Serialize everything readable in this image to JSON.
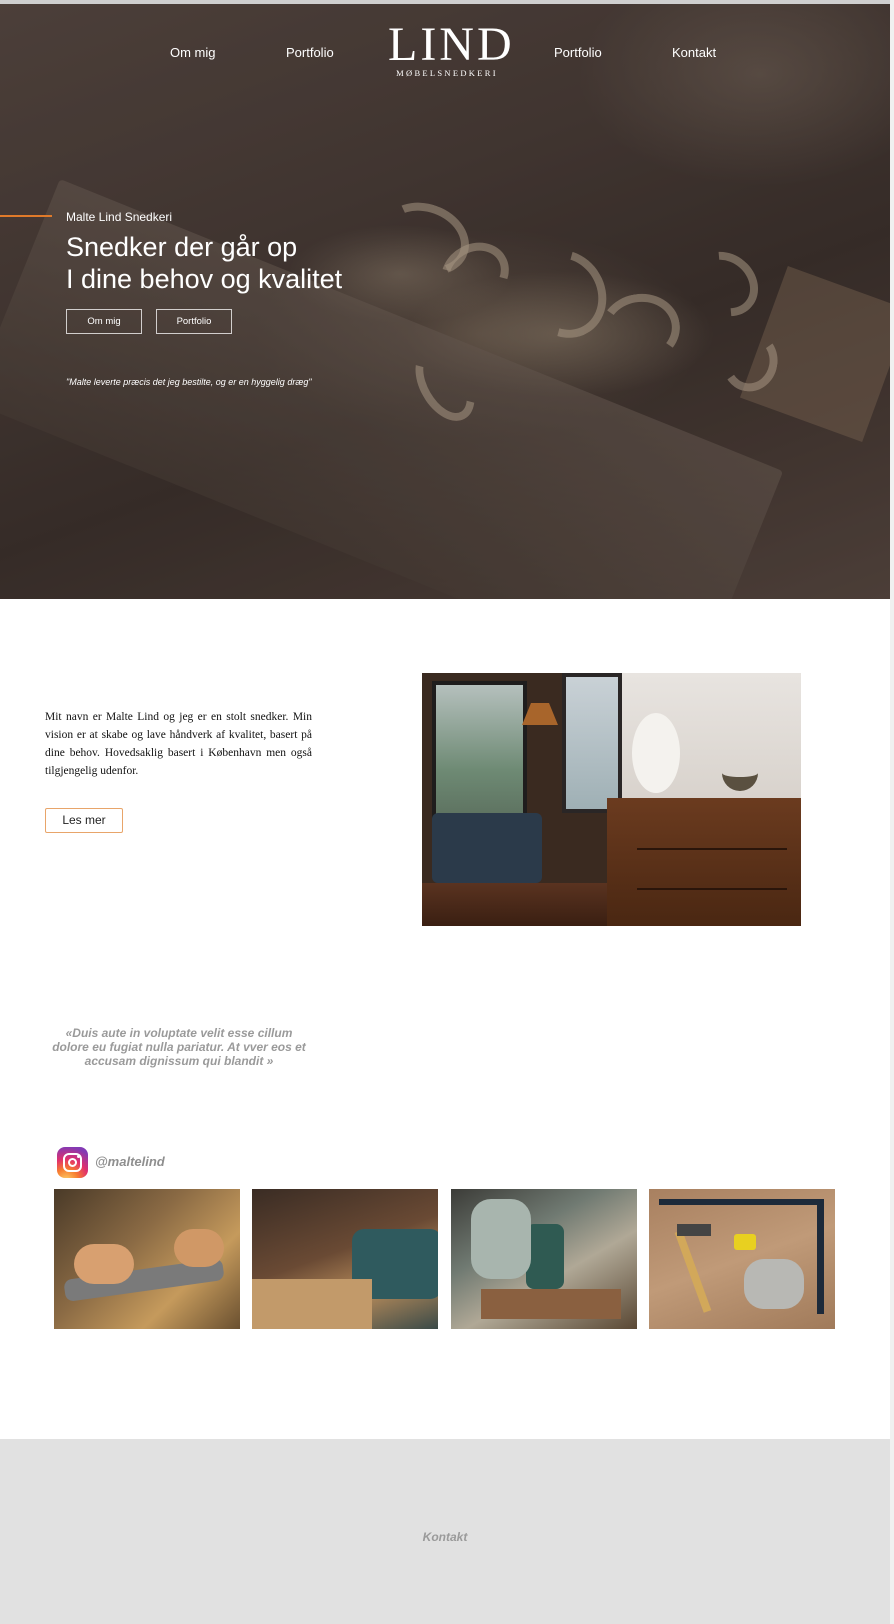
{
  "nav": {
    "left_items": [
      "Om mig",
      "Portfolio"
    ],
    "right_items": [
      "Portfolio",
      "Kontakt"
    ]
  },
  "logo": {
    "main": "LIND",
    "sub": "MØBELSNEDKERI"
  },
  "hero": {
    "kicker": "Malte Lind Snedkeri",
    "title_line1": "Snedker der går op",
    "title_line2": "I dine behov og kvalitet",
    "buttons": [
      "Om mig",
      "Portfolio"
    ],
    "quote": "\"Malte leverte præcis det jeg bestilte, og er en hyggelig dræg\"",
    "accent_color": "#e07a2a"
  },
  "about": {
    "text": "Mit navn er Malte Lind og jeg er en stolt snedker. Min vision er at skabe og lave håndverk af kvalitet, basert på dine behov. Hovedsaklig basert i København men også tilgjengelig udenfor.",
    "button": "Les mer",
    "button_border_color": "#e8a56a"
  },
  "testimonial": {
    "text": "«Duis aute in voluptate velit esse cillum dolore eu fugiat nulla pariatur. At vver eos et accusam dignissum qui blandit »"
  },
  "instagram": {
    "icon": "instagram-icon",
    "handle": "@maltelind"
  },
  "footer": {
    "label": "Kontakt",
    "background": "#e1e1e1"
  }
}
